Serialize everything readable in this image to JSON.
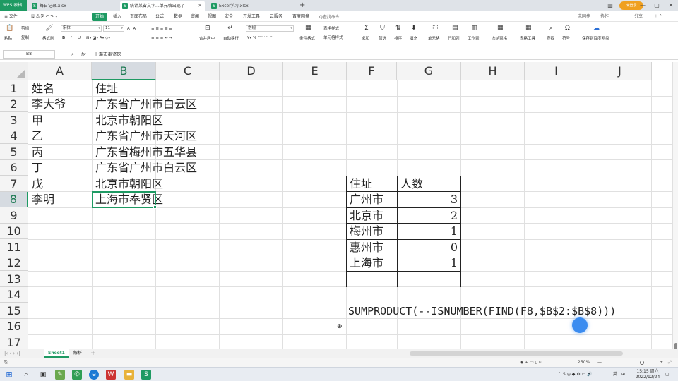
{
  "titlebar": {
    "app_badge": "WPS 表格",
    "tabs": [
      {
        "label": "每日记录.xlsx",
        "icon": "S"
      },
      {
        "label": "统计某省文字...单元格出现了",
        "icon": "S",
        "active": true
      },
      {
        "label": "Excel学习.xlsx",
        "icon": "S"
      }
    ],
    "new_tab": "+",
    "user": "未登录",
    "controls": {
      "min": "—",
      "max": "▢",
      "close": "✕"
    }
  },
  "menubar": {
    "file": "≡ 文件",
    "items": [
      "开始",
      "插入",
      "页面布局",
      "公式",
      "数据",
      "审阅",
      "视图",
      "安全",
      "开发工具",
      "云服务",
      "百度网盘"
    ],
    "active_item": "开始",
    "search": "Q查找命令",
    "sync": "未同步",
    "collab": "协作",
    "share": "分享"
  },
  "ribbon": {
    "cut": "剪切",
    "copy": "复制",
    "format_painter": "格式刷",
    "paste": "粘贴",
    "font_name": "宋体",
    "font_size": "11",
    "merge_center": "合并居中",
    "wrap": "自动换行",
    "number_format": "常规",
    "cond_format": "条件格式",
    "table_style": "表格样式",
    "cell_style": "单元格样式",
    "sum": "求和",
    "filter": "筛选",
    "sort": "排序",
    "fill": "填充",
    "cell": "单元格",
    "row_col": "行和列",
    "worksheet": "工作表",
    "freeze": "冻结窗格",
    "table_tools": "表格工具",
    "find": "查找",
    "symbol": "符号",
    "save_baidu": "保存到百度网盘"
  },
  "formulabar": {
    "name_box": "B8",
    "fx": "fx",
    "value": "上海市奉贤区"
  },
  "grid": {
    "columns": [
      "A",
      "B",
      "C",
      "D",
      "E",
      "F",
      "G",
      "H",
      "I",
      "J"
    ],
    "selected_column": "B",
    "rows": [
      "1",
      "2",
      "3",
      "4",
      "5",
      "6",
      "7",
      "8",
      "9",
      "10",
      "11",
      "12",
      "13",
      "14",
      "15",
      "16",
      "17"
    ],
    "selected_row": "8",
    "names_header": "姓名",
    "address_header": "住址",
    "records": [
      {
        "name": "李大爷",
        "address": "广东省广州市白云区"
      },
      {
        "name": "甲",
        "address": "北京市朝阳区"
      },
      {
        "name": "乙",
        "address": "广东省广州市天河区"
      },
      {
        "name": "丙",
        "address": "广东省梅州市五华县"
      },
      {
        "name": "丁",
        "address": "广东省广州市白云区"
      },
      {
        "name": "戊",
        "address": "北京市朝阳区"
      },
      {
        "name": "李明",
        "address": "上海市奉贤区"
      }
    ],
    "summary_header": {
      "place": "住址",
      "count": "人数"
    },
    "summary": [
      {
        "place": "广州市",
        "count": "3"
      },
      {
        "place": "北京市",
        "count": "2"
      },
      {
        "place": "梅州市",
        "count": "1"
      },
      {
        "place": "惠州市",
        "count": "0"
      },
      {
        "place": "上海市",
        "count": "1"
      }
    ],
    "formula_note": "SUMPRODUCT(--ISNUMBER(FIND(F8,$B$2:$B$8)))"
  },
  "sheets": {
    "tabs": [
      "Sheet1",
      "解析"
    ],
    "active": "Sheet1",
    "add": "+"
  },
  "statusbar": {
    "zoom": "250%",
    "minus": "—",
    "plus": "+"
  },
  "taskbar": {
    "tray_lang": "英",
    "time": "15:15 周六",
    "date": "2022/12/24"
  }
}
